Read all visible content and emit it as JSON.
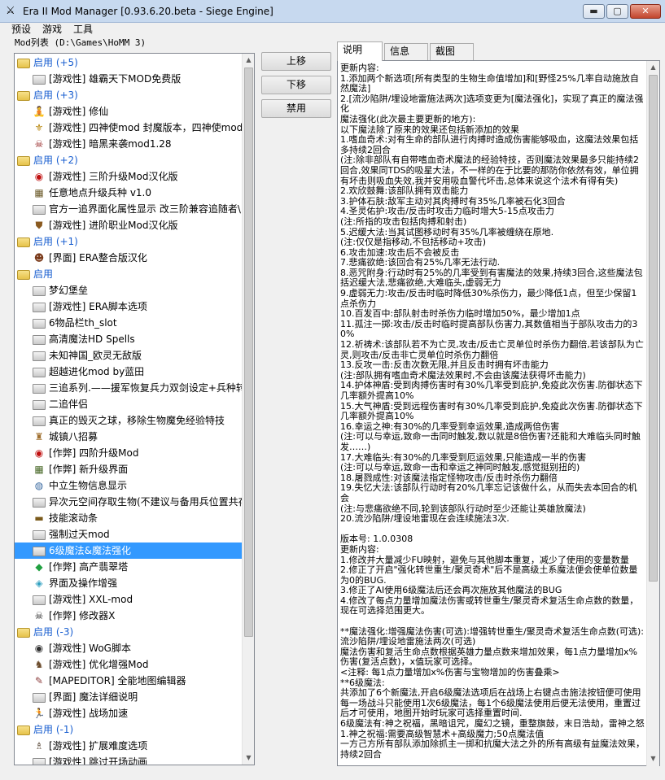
{
  "window": {
    "title": "Era II Mod Manager [0.93.6.20.beta - Siege Engine]",
    "app_icon": "crossed-swords-icon",
    "minimize_glyph": "▬",
    "maximize_glyph": "▢",
    "close_glyph": "✕"
  },
  "menu": [
    {
      "label": "预设"
    },
    {
      "label": "游戏"
    },
    {
      "label": "工具"
    }
  ],
  "mod_list_label": "Mod列表 (D:\\Games\\HoMM 3)",
  "tree": [
    {
      "type": "group",
      "label": "启用 (+5)"
    },
    {
      "type": "item",
      "label": "[游戏性] 雄霸天下MOD免费版",
      "icon": "folder-icon"
    },
    {
      "type": "group",
      "label": "启用 (+3)"
    },
    {
      "type": "item",
      "label": "[游戏性] 修仙",
      "icon": "monk-icon",
      "glyph": "🧘",
      "color": "#6a4a2a"
    },
    {
      "type": "item",
      "label": "[游戏性] 四神使mod 封魔版本，四神使mod",
      "icon": "emblem-icon",
      "glyph": "⚜",
      "color": "#b8860b"
    },
    {
      "type": "item",
      "label": "[游戏性] 暗黑来袭mod1.28",
      "icon": "demon-icon",
      "glyph": "☠",
      "color": "#8b1010"
    },
    {
      "type": "group",
      "label": "启用 (+2)"
    },
    {
      "type": "item",
      "label": "[游戏性] 三阶升级Mod汉化版",
      "icon": "red-orb-icon",
      "glyph": "◉",
      "color": "#c01010"
    },
    {
      "type": "item",
      "label": "任意地点升级兵种 v1.0",
      "icon": "map-icon",
      "glyph": "▦",
      "color": "#6b5a2a"
    },
    {
      "type": "item",
      "label": "官方一追界面化属性显示 改三阶兼容追随者\\",
      "icon": "folder-icon"
    },
    {
      "type": "item",
      "label": "[游戏性] 进阶职业Mod汉化版",
      "icon": "shield-icon",
      "glyph": "⛊",
      "color": "#8a5a20"
    },
    {
      "type": "group",
      "label": "启用 (+1)"
    },
    {
      "type": "item",
      "label": "[界面] ERA整合版汉化",
      "icon": "portrait-icon",
      "glyph": "☻",
      "color": "#7a3a1a"
    },
    {
      "type": "group",
      "label": "启用"
    },
    {
      "type": "item",
      "label": "梦幻堡垒",
      "icon": "folder-icon"
    },
    {
      "type": "item",
      "label": "[游戏性] ERA脚本选项",
      "icon": "folder-icon"
    },
    {
      "type": "item",
      "label": "6物品栏th_slot",
      "icon": "folder-icon"
    },
    {
      "type": "item",
      "label": "高清魔法HD Spells",
      "icon": "folder-icon"
    },
    {
      "type": "item",
      "label": "未知神国_欧灵无敌版",
      "icon": "folder-icon"
    },
    {
      "type": "item",
      "label": "超越进化mod by蓝田",
      "icon": "folder-icon"
    },
    {
      "type": "item",
      "label": "三追系列.——援军恢复兵力双剑设定+兵种转",
      "icon": "folder-icon"
    },
    {
      "type": "item",
      "label": "二追伴侣",
      "icon": "folder-icon"
    },
    {
      "type": "item",
      "label": "真正的毁灭之球，移除生物魔免经验特技",
      "icon": "folder-icon"
    },
    {
      "type": "item",
      "label": "城镇八招募",
      "icon": "castle-icon",
      "glyph": "♜",
      "color": "#a07030"
    },
    {
      "type": "item",
      "label": "[作弊] 四阶升级Mod",
      "icon": "red-orb-icon",
      "glyph": "◉",
      "color": "#c01010"
    },
    {
      "type": "item",
      "label": "[作弊] 新升级界面",
      "icon": "map-icon",
      "glyph": "▦",
      "color": "#4a6a2a"
    },
    {
      "type": "item",
      "label": "中立生物信息显示",
      "icon": "globe-icon",
      "glyph": "◍",
      "color": "#3a6aa0"
    },
    {
      "type": "item",
      "label": "异次元空间存取生物(不建议与备用兵位置共存",
      "icon": "folder-icon"
    },
    {
      "type": "item",
      "label": "技能滚动条",
      "icon": "scroll-bar-icon",
      "glyph": "▬",
      "color": "#7a5a1a"
    },
    {
      "type": "item",
      "label": "强制过天mod",
      "icon": "folder-icon"
    },
    {
      "type": "item",
      "label": "6级魔法&魔法强化",
      "icon": "folder-icon",
      "selected": true
    },
    {
      "type": "item",
      "label": "[作弊] 高产翡翠塔",
      "icon": "emerald-icon",
      "glyph": "◆",
      "color": "#20a040"
    },
    {
      "type": "item",
      "label": "界面及操作增强",
      "icon": "crystal-icon",
      "glyph": "◈",
      "color": "#30a0c0"
    },
    {
      "type": "item",
      "label": "[游戏性] XXL-mod",
      "icon": "folder-icon"
    },
    {
      "type": "item",
      "label": "[作弊] 修改器X",
      "icon": "skull-icon",
      "glyph": "☠",
      "color": "#202020"
    },
    {
      "type": "group",
      "label": "启用 (-3)"
    },
    {
      "type": "item",
      "label": "[游戏性] WoG脚本",
      "icon": "eye-icon",
      "glyph": "◉",
      "color": "#303030"
    },
    {
      "type": "item",
      "label": "[游戏性] 优化增强Mod",
      "icon": "horse-icon",
      "glyph": "♞",
      "color": "#6a4a2a"
    },
    {
      "type": "item",
      "label": "[MAPEDITOR] 全能地图编辑器",
      "icon": "editor-icon",
      "glyph": "✎",
      "color": "#8a3a3a"
    },
    {
      "type": "item",
      "label": "[界面] 魔法详细说明",
      "icon": "folder-icon"
    },
    {
      "type": "item",
      "label": "[游戏性] 战场加速",
      "icon": "runner-icon",
      "glyph": "🏃",
      "color": "#202020"
    },
    {
      "type": "group",
      "label": "启用 (-1)"
    },
    {
      "type": "item",
      "label": "[游戏性] 扩展难度选项",
      "icon": "knight-icon",
      "glyph": "♗",
      "color": "#5a4a3a"
    },
    {
      "type": "item",
      "label": "[游戏性] 跳过开场动画",
      "icon": "folder-icon"
    }
  ],
  "buttons": {
    "move_up": "上移",
    "move_down": "下移",
    "disable": "禁用"
  },
  "tabs": [
    {
      "label": "说明",
      "active": true
    },
    {
      "label": "信息",
      "active": false
    },
    {
      "label": "截图",
      "active": false
    }
  ],
  "description": "更新内容:\n1.添加两个新选项[所有类型的生物生命值增加]和[野怪25%几率自动施放自然魔法]\n2.[流沙陷阱/埋设地雷施法两次]选项变更为[魔法强化]，实现了真正的魔法强化\n魔法强化(此次最主要更新的地方):\n以下魔法除了原来的效果还包括新添加的效果\n1.嗜血奇术:对有生命的部队进行肉搏时造成伤害能够吸血，这魔法效果包括多持续2回合\n(注:除非部队有自带嗜血奇术魔法的经验特技，否则魔法效果最多只能持续2回合,效果同TDS的吸星大法，不一样的在于比要的那防你依然有效，单位拥有坏击则吸血失效,我并安用吸血警代坏击,总体来说这个法术有得有失)\n2.欢欣鼓舞:该部队拥有双击能力\n3.护体石肤:敌军主动对其肉搏时有35%几率被石化3回合\n4.圣灵佑护:攻击/反击时攻击力临时增大5-15点攻击力\n(注:所指的攻击包括肉搏和射击)\n5.迟缓大法:当其试图移动时有35%几率被缠绕在原地.\n(注:仅仅是指移动,不包括移动+攻击)\n6.攻击加速:攻击后不会被反击\n7.悲痛欲绝:该回合有25%几率无法行动.\n8.恶咒附身:行动时有25%的几率受到有害魔法的效果,持续3回合,这些魔法包括迟缓大法,悲痛欲绝,大难临头,虚弱无力\n9.虚弱无力:攻击/反击时临时降低30%杀伤力，最少降低1点，但至少保留1点杀伤力\n10.百发百中:部队射击时杀伤力临时增加50%，最少增加1点\n11.孤注一掷:攻击/反击时临时提高部队伤害力,其数值相当于部队攻击力的30%\n12.祈祷术:该部队若不为亡灵,攻击/反击亡灵单位时杀伤力翻倍,若该部队为亡灵,则攻击/反击非亡灵单位时杀伤力翻倍\n13.反攻一击:反击次数无限,并且反击时拥有坏击能力\n(注:部队拥有嗜血奇术魔法效果时,不会由该魔法获得坏击能力)\n14.护体神盾:受到肉搏伤害时有30%几率受到庇护,免疫此次伤害.防御状态下几率额外提高10%\n15.大气神盾:受到远程伤害时有30%几率受到庇护,免疫此次伤害.防御状态下几率额外提高10%\n16.幸运之神:有30%的几率受到幸运效果,造成两倍伤害\n(注:可以与幸运,致命一击同时触发,数以就是8倍伤害?还能和大难临头同时触发……)\n17.大难临头:有30%的几率受到厄运效果,只能造成一半的伤害\n(注:可以与幸运,致命一击和幸运之神同时触发,感觉挺别扭的)\n18.屠戮成性:对该魔法指定怪物攻击/反击时杀伤力翻倍\n19.失忆大法:该部队行动时有20%几率忘记该做什么，从而失去本回合的机会\n(注:与悲痛欲绝不同,轮到该部队行动时至少还能让英雄放魔法)\n20.流沙陷阱/埋设地雷现在会连续施法3次.\n\n版本号: 1.0.0308\n更新内容:\n1.修改并大量减少FU映射，避免与其他脚本重复，减少了使用的变量数量\n2.修正了开启\"强化转世重生/聚灵奇术\"后不是高级土系魔法便会使单位数量为0的BUG.\n3.修正了AI使用6级魔法后还会再次施放其他魔法的BUG\n4.修改了每点力量增加魔法伤害或转世重生/聚灵奇术复活生命点数的数量，现在可选择范围更大。\n\n**魔法强化:增强魔法伤害(可选):增强转世重生/聚灵奇术复活生命点数(可选):流沙陷阱/埋设地雷施法两次(可选)\n魔法伤害和复活生命点数根据英雄力量点数来增加效果，每1点力量增加x%伤害(复活点数)，x值玩家可选择。\n<注释: 每1点力量增加x%伤害与宝物增加的伤害叠乘>\n**6级魔法:\n共添加了6个新魔法,开启6级魔法选项后在战场上右键点击施法按钮便可使用\n每一场战斗只能使用1次6级魔法，每1个6级魔法使用后便无法使用，重置过后才可使用，地图开始时玩家可选择重置时间.\n6级魔法有:神之祝福，黑暗诅咒，魔幻之镜，重整旗鼓，末日浩劫，雷神之怒\n1.神之祝福:需要高级智慧术+高级魔力;50点魔法值\n一方己方所有部队添加除抓主一掷和抗魔大法之外的所有高级有益魔法效果，持续2回合"
}
